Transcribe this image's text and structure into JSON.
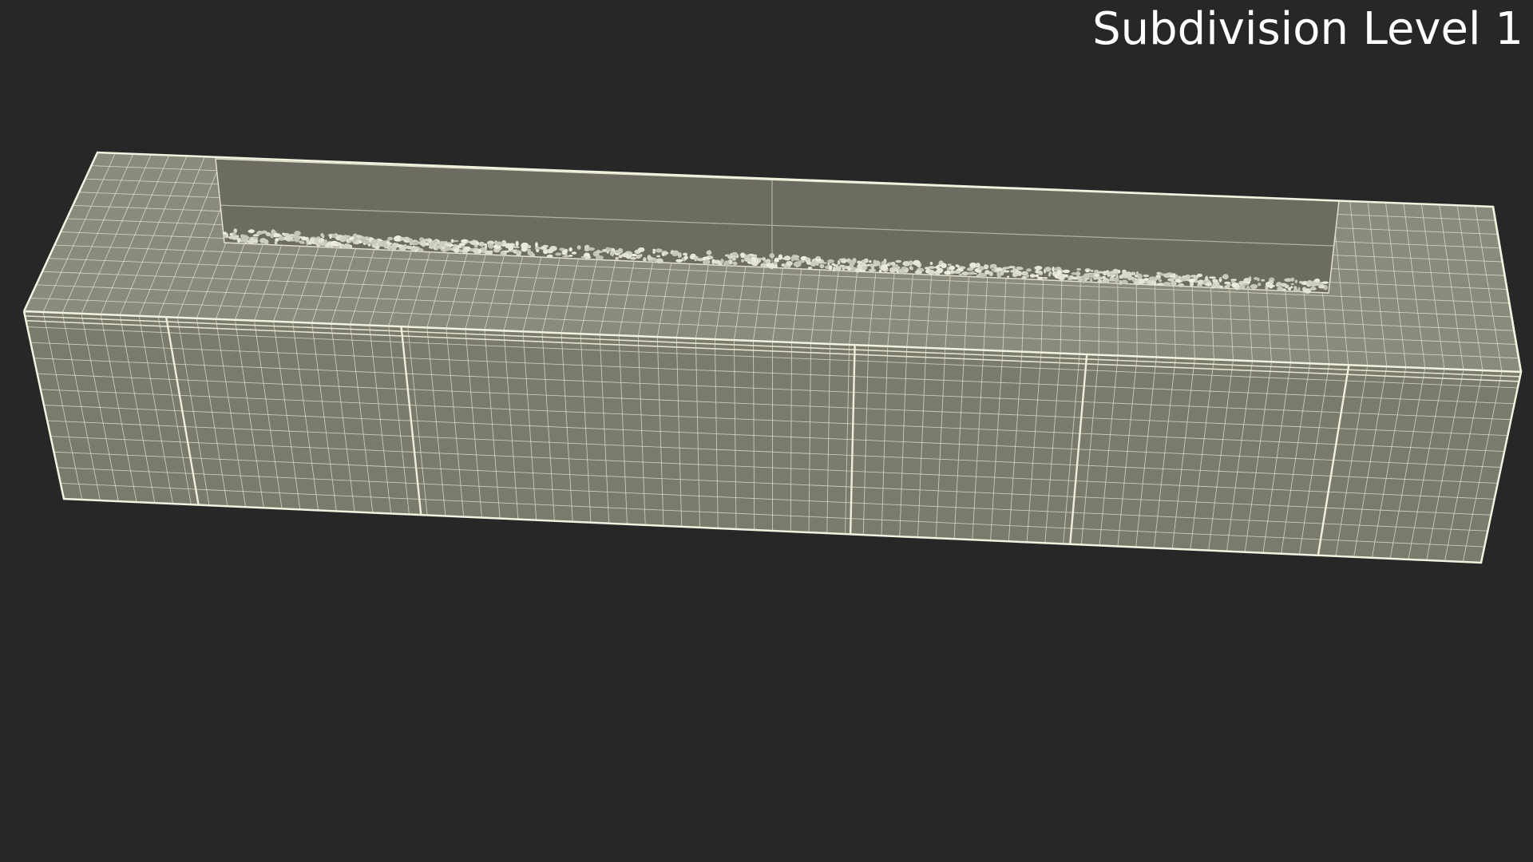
{
  "viewport": {
    "background_color": "#272727",
    "label": "Subdivision Level 1"
  },
  "model": {
    "subject": "rectangular fire pit planter with glass windscreen and pebble bed",
    "surface_color": "#7b7b6e",
    "top_surface_color": "#86867a",
    "glass_color": "#6d6d62",
    "wire_color": "#e6e6d2",
    "edge_color": "#f2f2e0",
    "pebble_color": "#d9d9cc"
  }
}
